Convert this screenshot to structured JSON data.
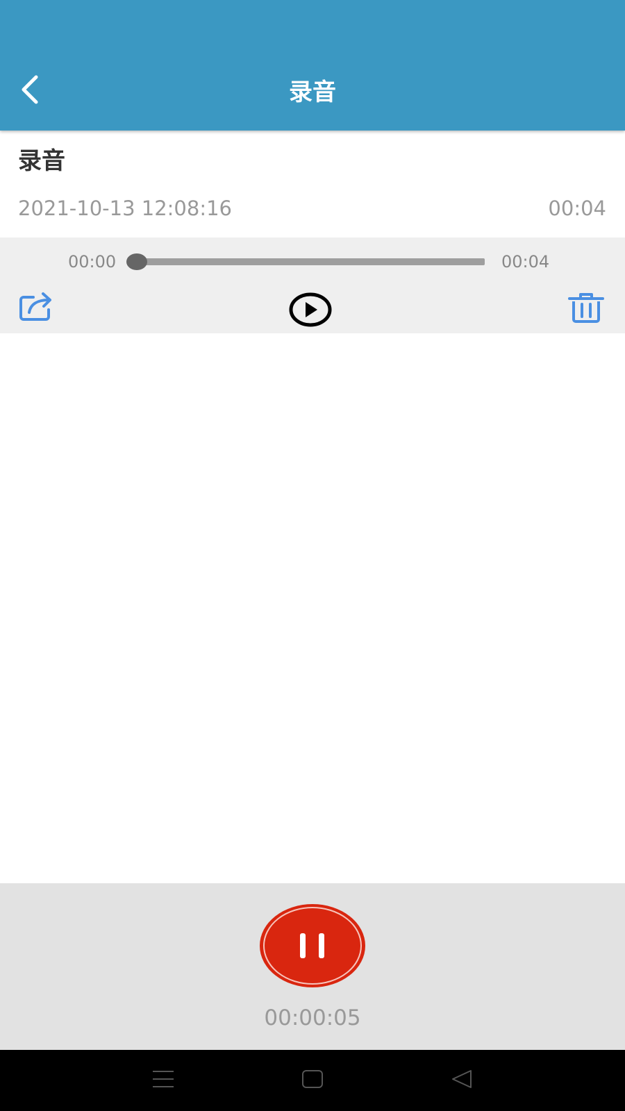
{
  "app_bar": {
    "title": "录音",
    "background": "#3b98c2",
    "back_icon": "chevron-left-icon"
  },
  "recording": {
    "name": "录音",
    "date": "2021-10-13 12:08:16",
    "duration": "00:04"
  },
  "player": {
    "current_time": "00:00",
    "total_time": "00:04",
    "progress": 0,
    "share_icon": "share-icon",
    "play_icon": "play-icon",
    "delete_icon": "trash-icon",
    "accent_color": "#4a8fe2"
  },
  "recorder": {
    "elapsed": "00:00:05",
    "button_icon": "pause-icon",
    "button_color": "#d9260f"
  },
  "system_nav": {
    "menu_icon": "menu-icon",
    "home_icon": "home-icon",
    "back_icon": "back-triangle-icon"
  }
}
